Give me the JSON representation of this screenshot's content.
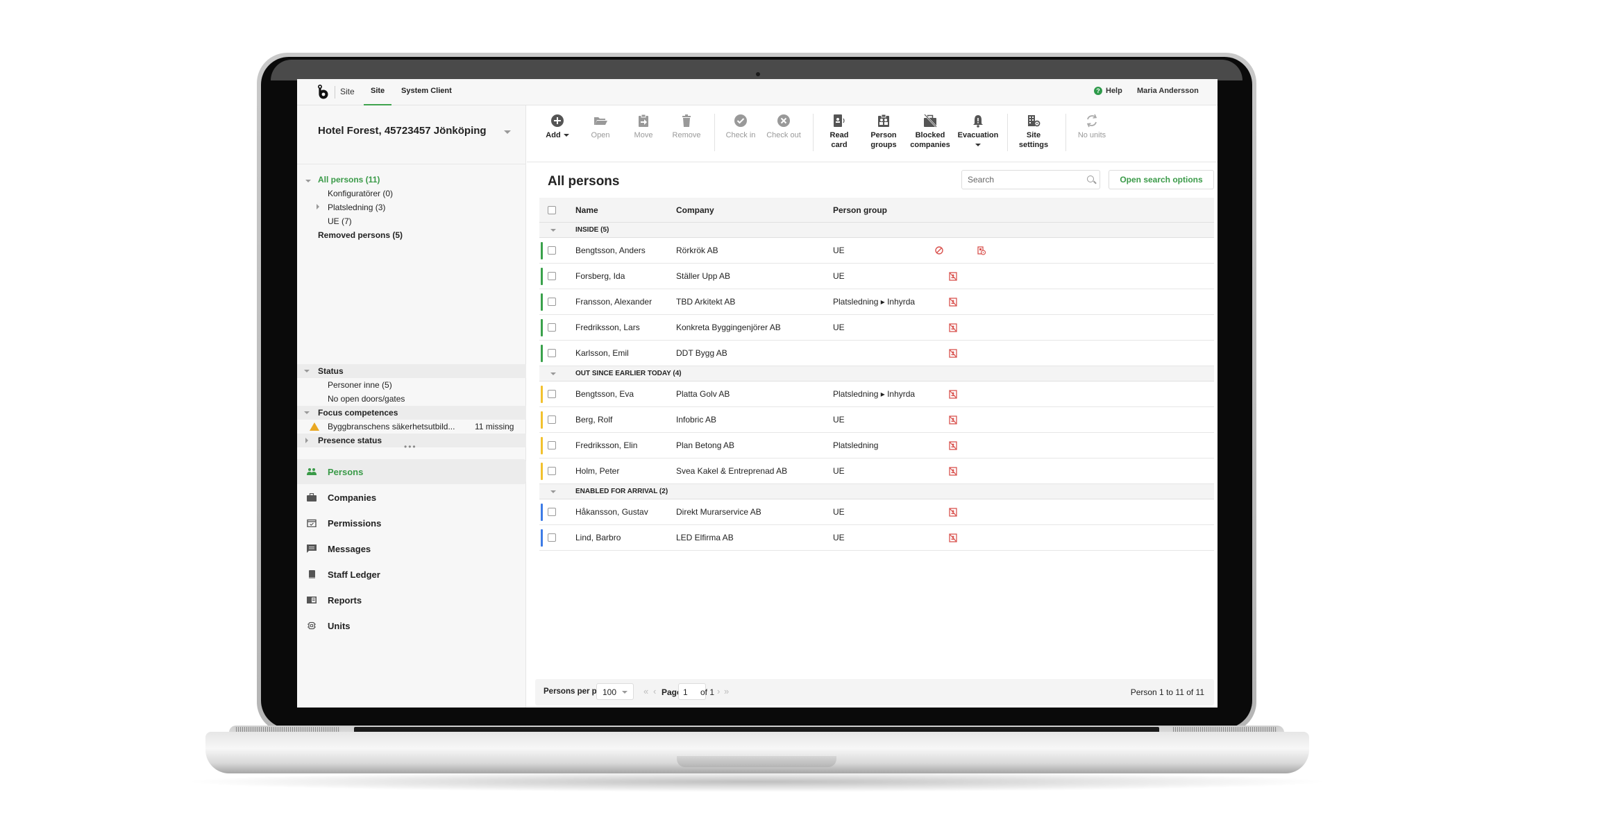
{
  "topbar": {
    "brand": "Site",
    "tabs": [
      {
        "label": "Site",
        "active": true
      },
      {
        "label": "System Client",
        "active": false
      }
    ],
    "help_label": "Help",
    "user_name": "Maria Andersson"
  },
  "sidebar": {
    "site_selector": "Hotel Forest, 45723457 Jönköping",
    "tree": [
      {
        "label": "All persons (11)",
        "selected": true,
        "expanded": true
      },
      {
        "label": "Konfiguratörer (0)"
      },
      {
        "label": "Platsledning (3)",
        "expandable": true
      },
      {
        "label": "UE (7)"
      },
      {
        "label": "Removed persons (5)"
      }
    ],
    "panels": {
      "status": {
        "title": "Status",
        "items": [
          "Personer inne (5)",
          "No open doors/gates"
        ]
      },
      "focus_competences": {
        "title": "Focus competences",
        "item_label": "Byggbranschens säkerhetsutbild...",
        "item_value": "11 missing"
      },
      "presence_status": {
        "title": "Presence status"
      }
    },
    "more_dots": "•••",
    "nav": [
      {
        "label": "Persons",
        "icon": "persons-icon",
        "active": true
      },
      {
        "label": "Companies",
        "icon": "briefcase-icon"
      },
      {
        "label": "Permissions",
        "icon": "calendar-check-icon"
      },
      {
        "label": "Messages",
        "icon": "message-icon"
      },
      {
        "label": "Staff Ledger",
        "icon": "book-icon"
      },
      {
        "label": "Reports",
        "icon": "reports-icon"
      },
      {
        "label": "Units",
        "icon": "chip-icon"
      }
    ]
  },
  "toolbar": {
    "add": "Add",
    "open": "Open",
    "move": "Move",
    "remove": "Remove",
    "check_in": "Check in",
    "check_out": "Check out",
    "read_card_1": "Read",
    "read_card_2": "card",
    "person_groups_1": "Person",
    "person_groups_2": "groups",
    "blocked_companies_1": "Blocked",
    "blocked_companies_2": "companies",
    "evacuation": "Evacuation",
    "site_settings_1": "Site",
    "site_settings_2": "settings",
    "no_units": "No units"
  },
  "main": {
    "title": "All persons",
    "search_placeholder": "Search",
    "open_search_options": "Open search options",
    "columns": {
      "name": "Name",
      "company": "Company",
      "person_group": "Person group"
    },
    "colors": {
      "inside": "#3aa14b",
      "out": "#f2c12e",
      "arrival": "#3d7be6",
      "alert": "#d9534f"
    },
    "groups": [
      {
        "label": "INSIDE (5)",
        "status": "inside",
        "rows": [
          {
            "name": "Bengtsson, Anders",
            "company": "Rörkrök AB",
            "group": "UE",
            "icons": [
              "blocked-icon",
              "card-alert-icon"
            ]
          },
          {
            "name": "Forsberg, Ida",
            "company": "Ställer Upp AB",
            "group": "UE",
            "icons": [
              "no-card-icon"
            ]
          },
          {
            "name": "Fransson, Alexander",
            "company": "TBD Arkitekt AB",
            "group": "Platsledning ▸ Inhyrda",
            "icons": [
              "no-card-icon"
            ]
          },
          {
            "name": "Fredriksson, Lars",
            "company": "Konkreta Byggingenjörer AB",
            "group": "UE",
            "icons": [
              "no-card-icon"
            ]
          },
          {
            "name": "Karlsson, Emil",
            "company": "DDT Bygg AB",
            "group": "",
            "icons": [
              "no-card-icon"
            ]
          }
        ]
      },
      {
        "label": "OUT SINCE EARLIER TODAY (4)",
        "status": "out",
        "rows": [
          {
            "name": "Bengtsson, Eva",
            "company": "Platta Golv AB",
            "group": "Platsledning ▸ Inhyrda",
            "icons": [
              "no-card-icon"
            ]
          },
          {
            "name": "Berg, Rolf",
            "company": "Infobric AB",
            "group": "UE",
            "icons": [
              "no-card-icon"
            ]
          },
          {
            "name": "Fredriksson, Elin",
            "company": "Plan Betong AB",
            "group": "Platsledning",
            "icons": [
              "no-card-icon"
            ]
          },
          {
            "name": "Holm, Peter",
            "company": "Svea Kakel & Entreprenad AB",
            "group": "UE",
            "icons": [
              "no-card-icon"
            ]
          }
        ]
      },
      {
        "label": "ENABLED FOR ARRIVAL (2)",
        "status": "arrival",
        "rows": [
          {
            "name": "Håkansson, Gustav",
            "company": "Direkt Murarservice AB",
            "group": "UE",
            "icons": [
              "no-card-icon"
            ]
          },
          {
            "name": "Lind, Barbro",
            "company": "LED Elfirma AB",
            "group": "UE",
            "icons": [
              "no-card-icon"
            ]
          }
        ]
      }
    ],
    "footer": {
      "per_page_label": "Persons per page",
      "per_page_value": "100",
      "page_label": "Page",
      "page_value": "1",
      "of_label": "of 1",
      "range_text": "Person 1 to 11 of 11"
    }
  }
}
